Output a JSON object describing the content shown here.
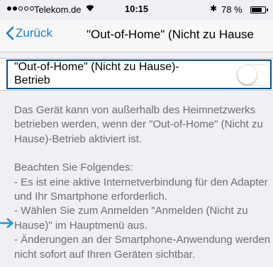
{
  "status_bar": {
    "carrier": "Telekom.de",
    "time": "10:15",
    "battery": "78 %",
    "battery_level": 0.78
  },
  "nav": {
    "back_label": "Zurück",
    "title": "\"Out-of-Home\" (Nicht zu Hause"
  },
  "setting": {
    "label": "\"Out-of-Home\" (Nicht zu Hause)-Betrieb",
    "enabled": false
  },
  "description": {
    "intro": "Das Gerät kann von außerhalb des Heimnetzwerks betrieben werden, wenn der \"Out-of-Home\" (Nicht zu Hause)-Betrieb aktiviert ist.",
    "heading": "Beachten Sie Folgendes:",
    "bullets": [
      "- Es ist eine aktive Internetverbindung für den Adapter und Ihr Smartphone erforderlich.",
      "- Wählen Sie zum Anmelden \"Anmelden (Nicht zu Hause)\" im Hauptmenü aus.",
      "- Änderungen an der Smartphone-Anwendung werden nicht sofort auf Ihren Geräten sichtbar."
    ]
  },
  "colors": {
    "accent": "#1a7ccf",
    "highlight": "#0f4c7d",
    "arrow": "#1f95d3"
  }
}
